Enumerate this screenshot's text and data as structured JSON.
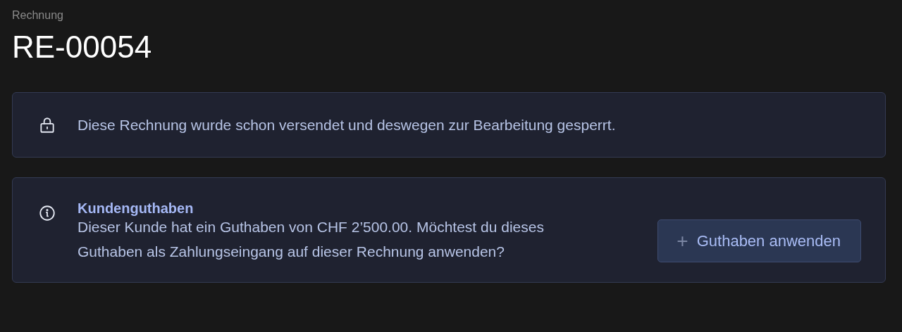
{
  "header": {
    "eyebrow": "Rechnung",
    "title": "RE-00054"
  },
  "callouts": [
    {
      "kind": "lock",
      "message": "Diese Rechnung wurde schon versendet und deswegen zur Bearbeitung gesperrt."
    },
    {
      "kind": "info",
      "title": "Kundenguthaben",
      "message": "Dieser Kunde hat ein Guthaben von CHF 2’500.00. Möchtest du dieses Guthaben als Zahlungseingang auf dieser Rechnung anwenden?",
      "button": {
        "label": "Guthaben anwenden",
        "icon": "+"
      }
    }
  ]
}
